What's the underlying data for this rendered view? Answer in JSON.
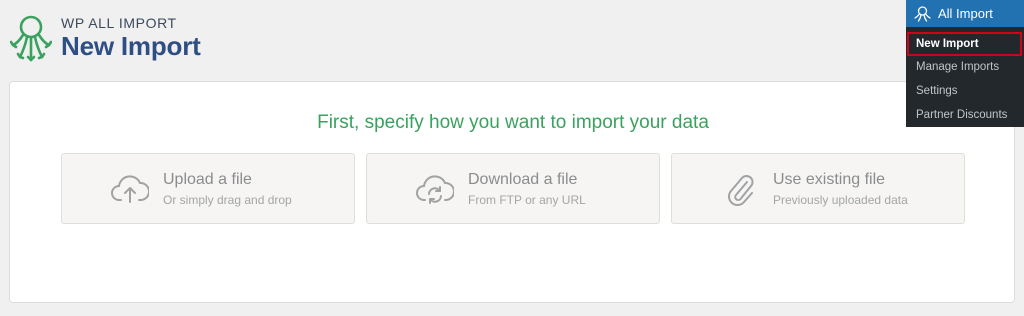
{
  "header": {
    "brand_small": "WP ALL IMPORT",
    "title": "New Import",
    "logo_icon": "octopus-logo-icon"
  },
  "main": {
    "heading": "First, specify how you want to import your data",
    "options": [
      {
        "title": "Upload a file",
        "subtitle": "Or simply drag and drop",
        "icon": "cloud-upload-icon"
      },
      {
        "title": "Download a file",
        "subtitle": "From FTP or any URL",
        "icon": "cloud-sync-icon"
      },
      {
        "title": "Use existing file",
        "subtitle": "Previously uploaded data",
        "icon": "paperclip-icon"
      }
    ]
  },
  "admin_menu": {
    "label": "All Import",
    "items": [
      {
        "label": "New Import",
        "active": true
      },
      {
        "label": "Manage Imports"
      },
      {
        "label": "Settings"
      },
      {
        "label": "Partner Discounts"
      }
    ]
  },
  "colors": {
    "brand_green": "#3aa25e",
    "brand_blue": "#2f4e84",
    "menu_blue": "#2271b1",
    "menu_dark": "#23282d",
    "active_outline": "#d0021b"
  }
}
